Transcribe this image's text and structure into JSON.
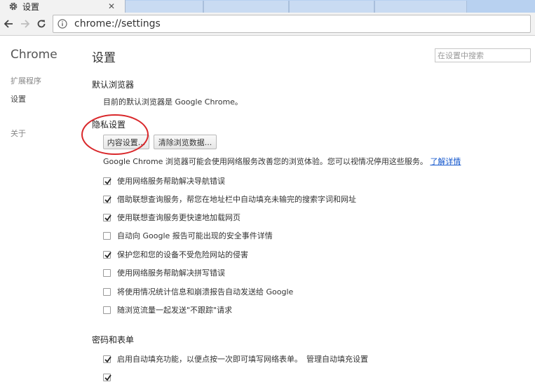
{
  "tab": {
    "title": "设置",
    "close": "✕"
  },
  "omnibox": {
    "url": "chrome://settings"
  },
  "sidebar": {
    "brand": "Chrome",
    "items": [
      {
        "label": "扩展程序"
      },
      {
        "label": "设置"
      },
      {
        "label": "关于"
      }
    ]
  },
  "header": {
    "title": "设置",
    "search_placeholder": "在设置中搜索"
  },
  "default_browser": {
    "heading": "默认浏览器",
    "text": "目前的默认浏览器是 Google Chrome。"
  },
  "privacy": {
    "heading": "隐私设置",
    "buttons": [
      "内容设置...",
      "清除浏览数据..."
    ],
    "description": "Google Chrome 浏览器可能会使用网络服务改善您的浏览体验。您可以视情况停用这些服务。",
    "learn_more": "了解详情",
    "options": [
      {
        "label": "使用网络服务帮助解决导航错误",
        "checked": true
      },
      {
        "label": "借助联想查询服务，帮您在地址栏中自动填充未输完的搜索字词和网址",
        "checked": true
      },
      {
        "label": "使用联想查询服务更快速地加载网页",
        "checked": true
      },
      {
        "label": "自动向 Google 报告可能出现的安全事件详情",
        "checked": false
      },
      {
        "label": "保护您和您的设备不受危险网站的侵害",
        "checked": true
      },
      {
        "label": "使用网络服务帮助解决拼写错误",
        "checked": false
      },
      {
        "label": "将使用情况统计信息和崩溃报告自动发送给 Google",
        "checked": false
      },
      {
        "label": "随浏览流量一起发送\"不跟踪\"请求",
        "checked": false
      }
    ]
  },
  "passwords": {
    "heading": "密码和表单",
    "autofill_label": "启用自动填充功能，以便点按一次即可填写网络表单。",
    "autofill_link": "管理自动填充设置",
    "autofill_checked": true
  },
  "colors": {
    "accent": "#1155cc",
    "annotation": "#d9282b",
    "tabstrip": "#b8d1f0"
  }
}
